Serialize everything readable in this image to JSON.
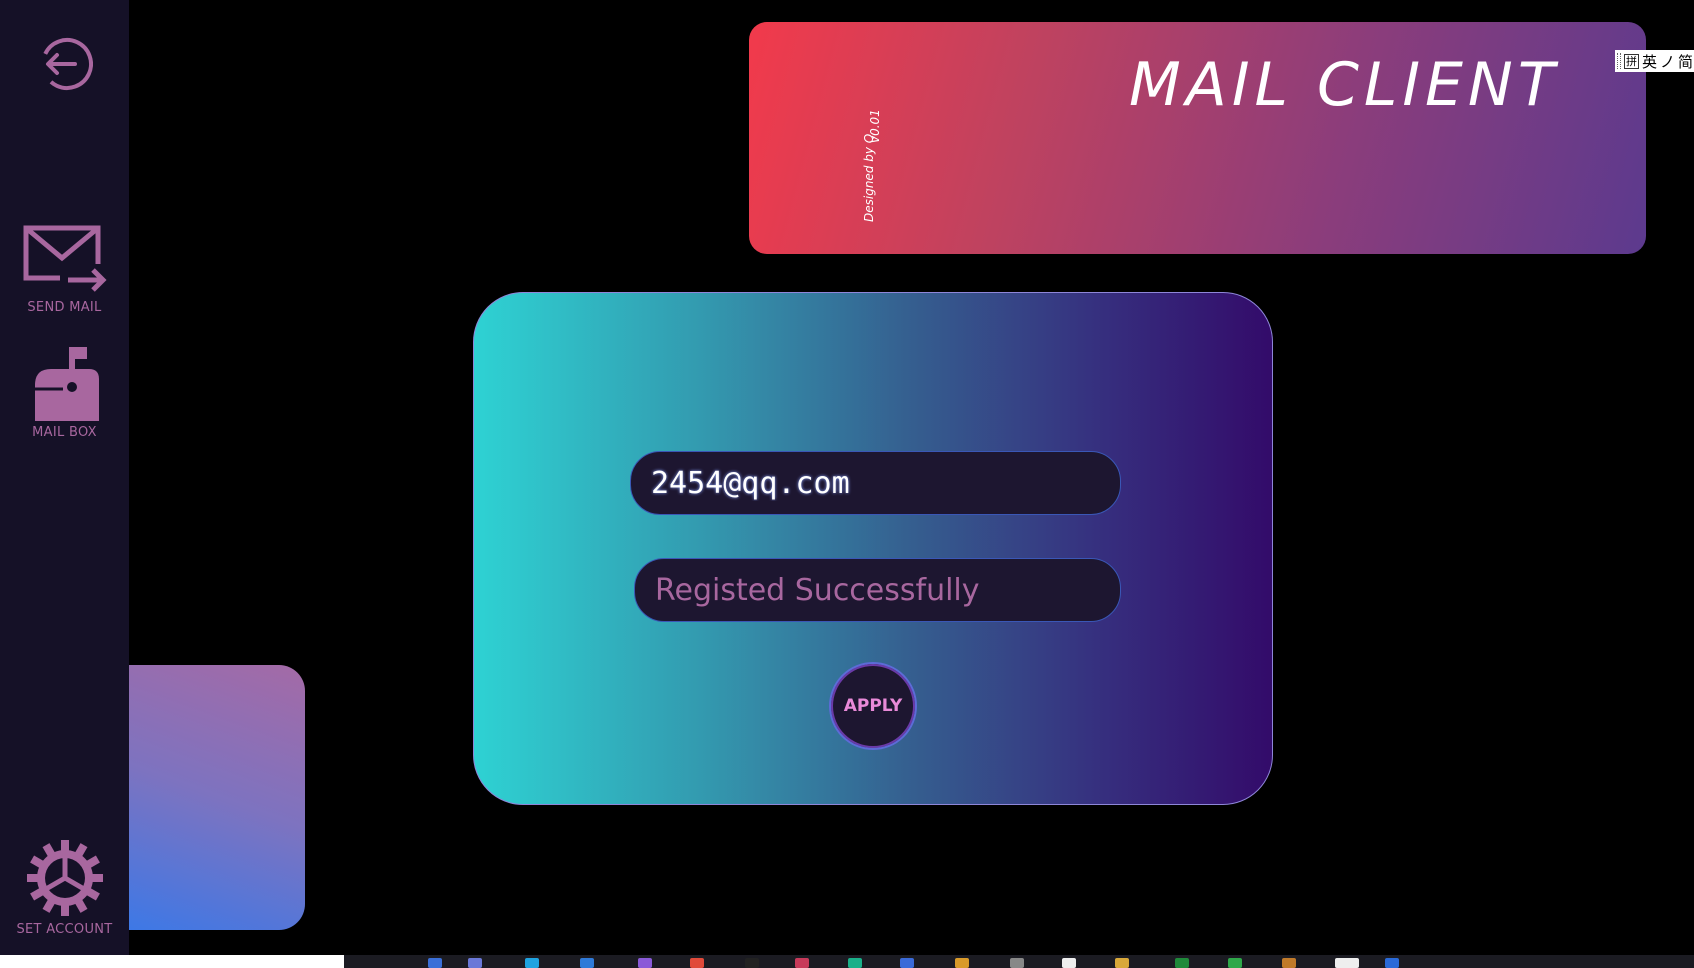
{
  "sidebar": {
    "items": [
      {
        "id": "back",
        "label": "",
        "icon": "logout-icon"
      },
      {
        "id": "send",
        "label": "SEND MAIL",
        "icon": "send-mail-icon"
      },
      {
        "id": "mailbox",
        "label": "MAIL BOX",
        "icon": "mailbox-icon"
      },
      {
        "id": "account",
        "label": "SET ACCOUNT",
        "icon": "gear-icon"
      }
    ]
  },
  "banner": {
    "title": "MAIL CLIENT",
    "credit": "Designed by Q",
    "version": "v0.01"
  },
  "form": {
    "email_value": "2454@qq.com",
    "status_text": "Registed Successfully",
    "apply_label": "APPLY"
  },
  "ime": {
    "box": "拼",
    "lang": "英",
    "extra": "ノ",
    "cut": "简"
  },
  "colors": {
    "sidebar_bg": "#151127",
    "accent_pink": "#a8679f",
    "apply_text": "#e98ad9",
    "banner_start": "#f23a4b",
    "banner_end": "#5c3a8e",
    "card_start": "#2ed2d3",
    "card_end": "#330b6a"
  }
}
